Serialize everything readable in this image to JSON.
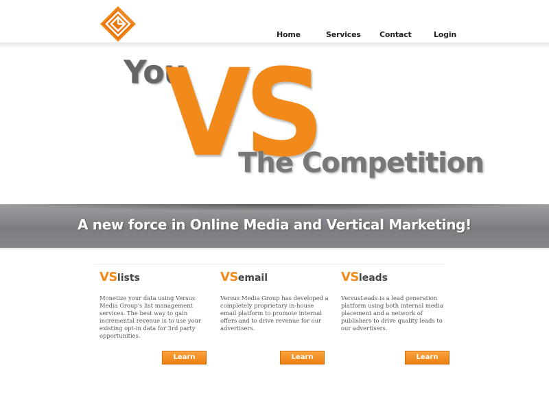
{
  "header": {
    "logo_icon": "diamond-logo-icon",
    "nav": [
      {
        "label": "Home"
      },
      {
        "label": "Services"
      },
      {
        "label": "Contact"
      },
      {
        "label": "Login"
      }
    ]
  },
  "hero": {
    "you": "You",
    "vs": "VS",
    "competition": "The Competition"
  },
  "banner": {
    "text": "A new force in Online Media and Vertical Marketing!"
  },
  "columns": [
    {
      "title_vs": "VS",
      "title_rest": "lists",
      "text": "Monetize your data using Versus Media Group's list management services. The best way to gain incremental revenue is to use your existing opt-in data for 3rd party opportunities.",
      "button": "Learn More"
    },
    {
      "title_vs": "VS",
      "title_rest": "email",
      "text": "Versus Media Group has developed a completely proprietary in-house email platform to promote internal offers and to drive revenue for our advertisers.",
      "button": "Learn More"
    },
    {
      "title_vs": "VS",
      "title_rest": "leads",
      "text": "VersusLeads is a lead generation platform using both internal media placement and a network of publishers to drive quality leads to our advertisers.",
      "button": "Learn More"
    }
  ],
  "colors": {
    "accent": "#f28a1b",
    "banner": "#7c7d80",
    "hero_gray": "#666666"
  }
}
